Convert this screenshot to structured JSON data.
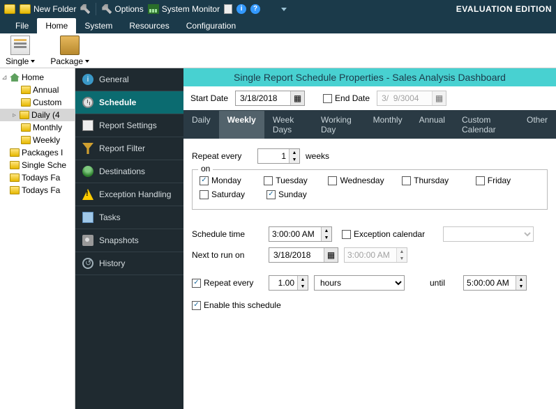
{
  "toolbar": {
    "new_folder": "New Folder",
    "options": "Options",
    "system_monitor": "System Monitor",
    "edition": "EVALUATION EDITION"
  },
  "ribbon_tabs": {
    "file": "File",
    "home": "Home",
    "system": "System",
    "resources": "Resources",
    "configuration": "Configuration"
  },
  "ribbon_btns": {
    "single": "Single",
    "package": "Package"
  },
  "tree": {
    "home": "Home",
    "annual": "Annual",
    "custom": "Custom",
    "daily": "Daily (4",
    "monthly": "Monthly",
    "weekly": "Weekly",
    "packages": "Packages I",
    "single_sche": "Single Sche",
    "todays_fa1": "Todays Fa",
    "todays_fa2": "Todays Fa"
  },
  "side_items": {
    "general": "General",
    "schedule": "Schedule",
    "report_settings": "Report Settings",
    "report_filter": "Report Filter",
    "destinations": "Destinations",
    "exception": "Exception Handling",
    "tasks": "Tasks",
    "snapshots": "Snapshots",
    "history": "History"
  },
  "title": "Single Report Schedule Properties - Sales Analysis Dashboard",
  "dates": {
    "start_lbl": "Start Date",
    "start_val": "3/18/2018",
    "end_lbl": "End Date",
    "end_val": "3/  9/3004"
  },
  "freq": {
    "daily": "Daily",
    "weekly": "Weekly",
    "weekdays": "Week Days",
    "workingday": "Working Day",
    "monthly": "Monthly",
    "annual": "Annual",
    "custom": "Custom Calendar",
    "other": "Other"
  },
  "form": {
    "repeat_every": "Repeat every",
    "repeat_val": "1",
    "weeks": "weeks",
    "on": "on",
    "mon": "Monday",
    "tue": "Tuesday",
    "wed": "Wednesday",
    "thu": "Thursday",
    "fri": "Friday",
    "sat": "Saturday",
    "sun": "Sunday",
    "schedule_time": "Schedule time",
    "schedule_time_val": "3:00:00 AM",
    "exception_cal": "Exception calendar",
    "next_run": "Next to run on",
    "next_date": "3/18/2018",
    "next_time": "3:00:00 AM",
    "repeat2": "Repeat every",
    "repeat2_val": "1.00",
    "hours": "hours",
    "until": "until",
    "until_val": "5:00:00 AM",
    "enable": "Enable this schedule"
  }
}
